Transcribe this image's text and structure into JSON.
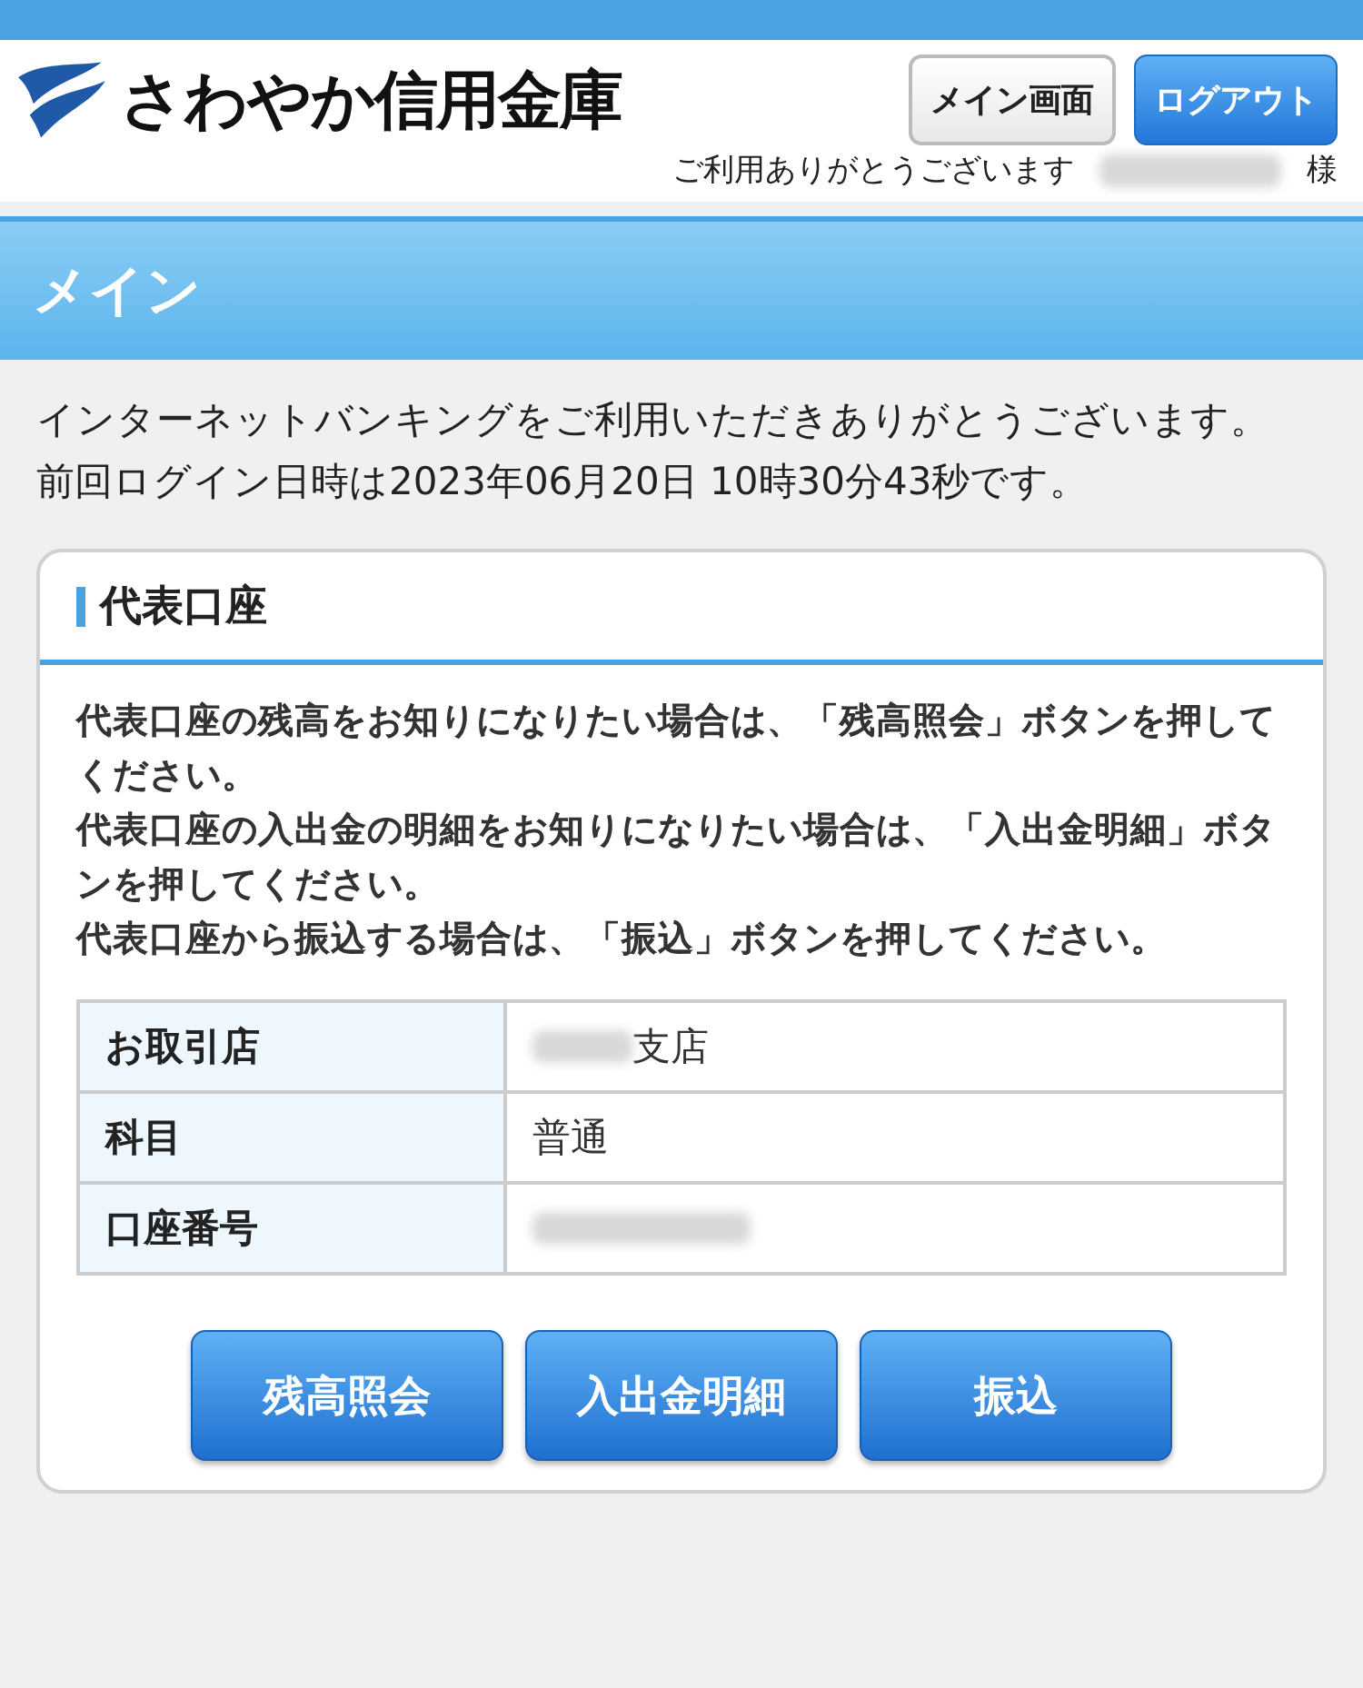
{
  "header": {
    "bank_name": "さわやか信用金庫",
    "buttons": [
      {
        "label": "メイン画面",
        "kind": "plain"
      },
      {
        "label": "ログアウト",
        "kind": "primary"
      }
    ],
    "greeting": "ご利用ありがとうございます",
    "honorific": "様"
  },
  "page_title": "メイン",
  "welcome": "インターネットバンキングをご利用いただきありがとうございます。",
  "last_login": "前回ログイン日時は2023年06月20日 10時30分43秒です。",
  "account_card": {
    "title": "代表口座",
    "instructions": [
      "代表口座の残高をお知りになりたい場合は、「残高照会」ボタンを押してください。",
      "代表口座の入出金の明細をお知りになりたい場合は、「入出金明細」ボタンを押してください。",
      "代表口座から振込する場合は、「振込」ボタンを押してください。"
    ],
    "rows": [
      {
        "label": "お取引店",
        "value": "支店",
        "redacted": true
      },
      {
        "label": "科目",
        "value": "普通",
        "redacted": false
      },
      {
        "label": "口座番号",
        "value": "",
        "redacted": true
      }
    ],
    "buttons": [
      "残高照会",
      "入出金明細",
      "振込"
    ]
  }
}
